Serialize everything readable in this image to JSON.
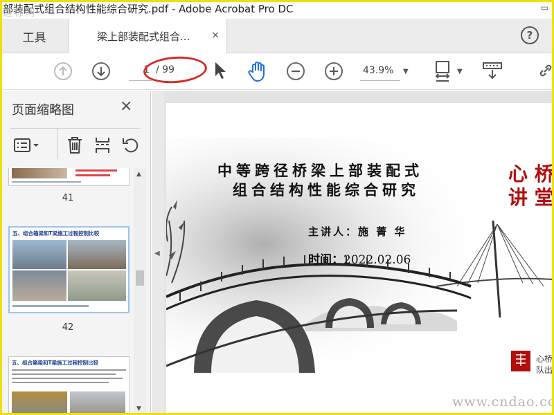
{
  "window": {
    "title": "部装配式组合结构性能综合研究.pdf - Adobe Acrobat Pro DC",
    "watermark_top": "道标网"
  },
  "tabs": {
    "tools_label": "工具",
    "document_label": "梁上部装配式组合...",
    "close_icon": "×",
    "help_icon": "?"
  },
  "toolbar": {
    "current_page": "1",
    "total_pages": "/ 99",
    "zoom": "43.9%",
    "icons": [
      "arrow-up-icon",
      "arrow-down-icon",
      "select-pointer-icon",
      "hand-icon",
      "zoom-out-icon",
      "zoom-in-icon",
      "fit-page-icon",
      "scroll-mode-icon",
      "link-icon"
    ]
  },
  "left_panel": {
    "title": "页面缩略图",
    "close_icon": "×",
    "thumbnails": [
      {
        "label": "41"
      },
      {
        "label": "42",
        "title": "五、组合箱梁和T梁施工过程控制比较"
      },
      {
        "title": "五、组合箱梁和T梁施工过程控制比较"
      }
    ]
  },
  "slide": {
    "title_line1": "中等跨径桥梁上部装配式",
    "title_line2": "组合结构性能综合研究",
    "speaker": "主讲人：施 菁 华",
    "time_label": "时间：",
    "time_value": "2022.02.06",
    "calligraphy": "心 桥 讲 堂",
    "seal_text": "心桥\n队出"
  },
  "watermark": "www.cndao.com",
  "colors": {
    "accent_red": "#d92a25",
    "title_blue": "#1d3f8f",
    "frame_yellow": "#f0e000"
  }
}
